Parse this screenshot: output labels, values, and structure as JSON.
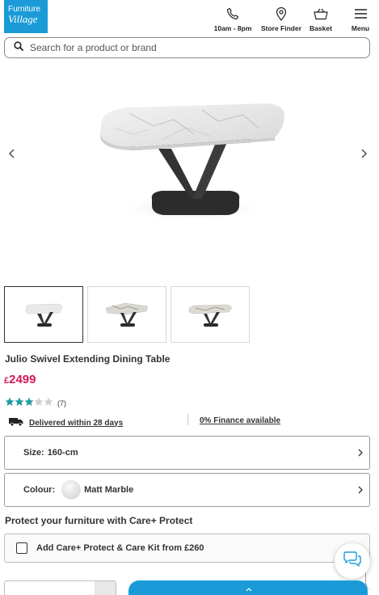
{
  "header": {
    "logo_line1": "Furniture",
    "logo_line2": "Village",
    "phone_label": "10am - 8pm",
    "store_label": "Store Finder",
    "basket_label": "Basket",
    "menu_label": "Menu",
    "icons": [
      "phone-icon",
      "location-pin-icon",
      "basket-icon",
      "hamburger-menu-icon"
    ]
  },
  "search": {
    "placeholder": "Search for a product or brand"
  },
  "product": {
    "title": "Julio Swivel Extending Dining Table",
    "currency": "£",
    "price": "2499",
    "rating_value": 3.5,
    "rating_max": 5,
    "review_count": "(7)",
    "delivery_text": "Delivered within 28 days",
    "finance_text": "0% Finance available"
  },
  "gallery": {
    "thumb_count": 3,
    "active_index": 0
  },
  "options": {
    "size_label": "Size:",
    "size_value": "160-cm",
    "colour_label": "Colour:",
    "colour_value": "Matt Marble"
  },
  "protect": {
    "title": "Protect your furniture with Care+ Protect",
    "checkbox_label": "Add Care+ Protect & Care Kit from £260"
  },
  "colors": {
    "brand_blue": "#1a9bd7",
    "price_pink": "#d31b5a",
    "star_teal": "#1f9aa0"
  }
}
